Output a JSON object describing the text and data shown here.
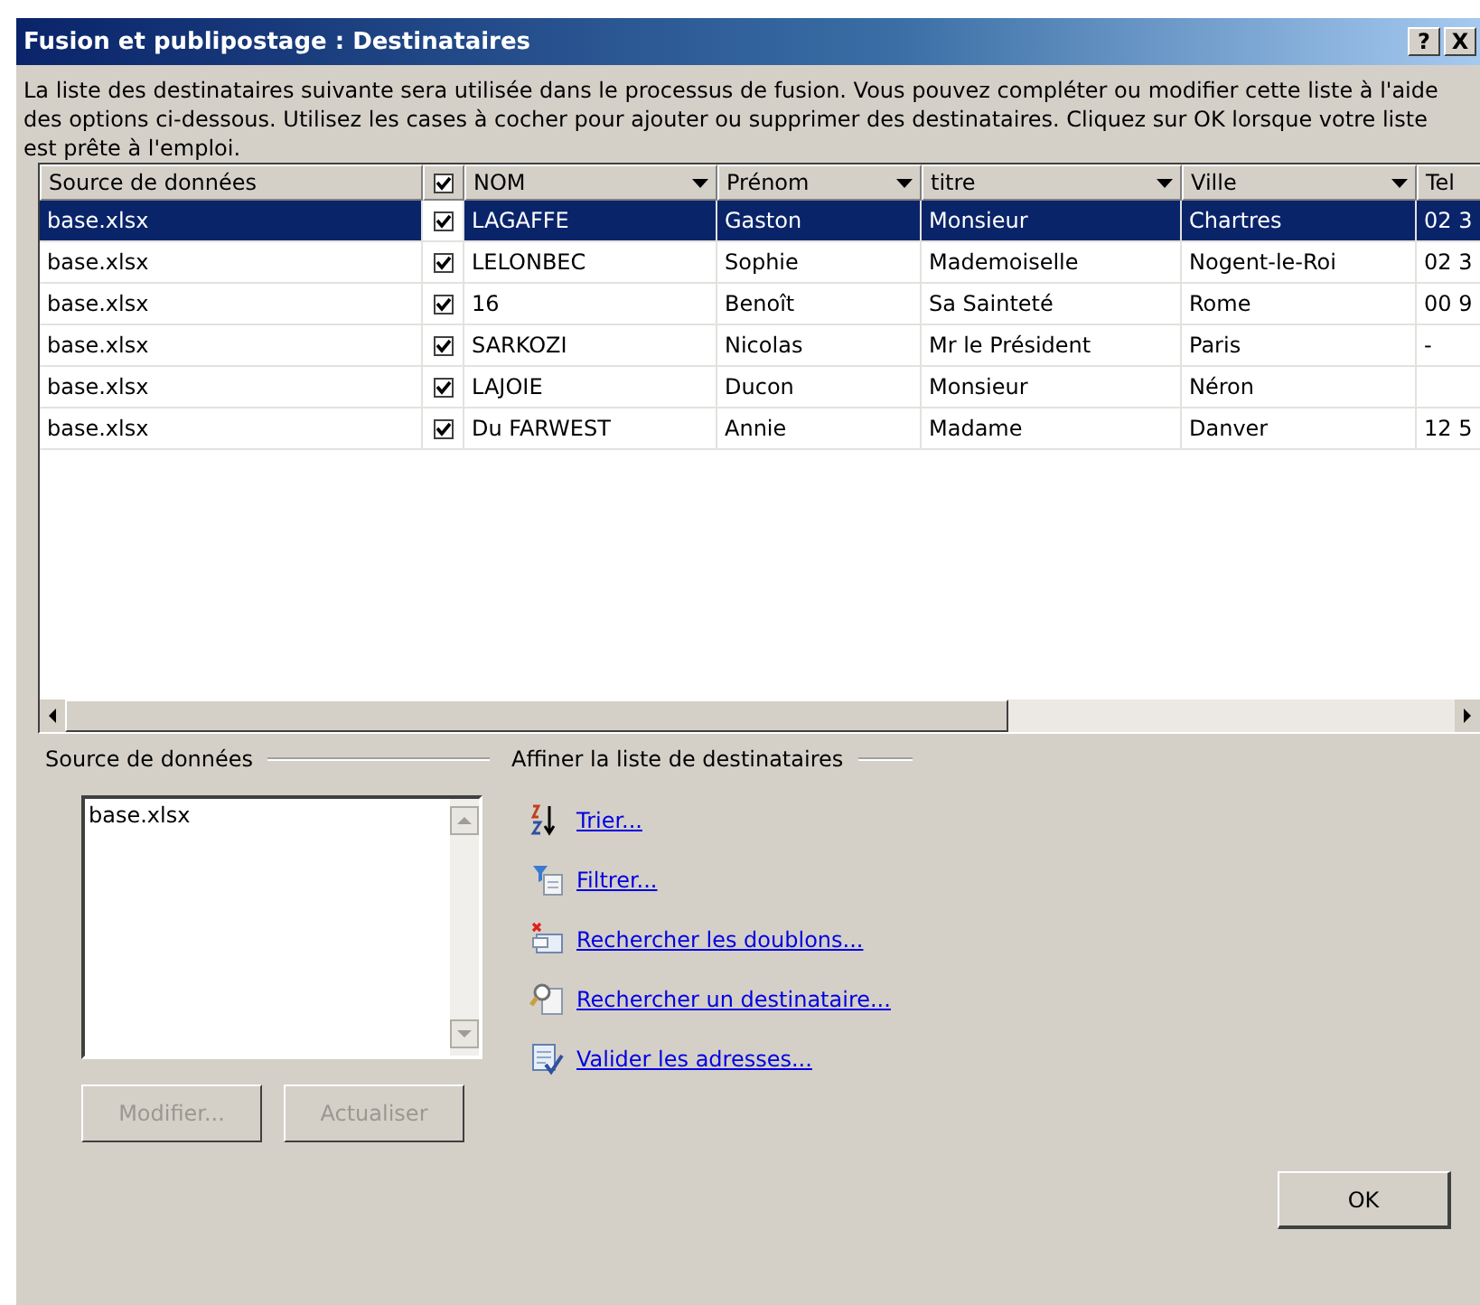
{
  "window": {
    "title": "Fusion et publipostage : Destinataires",
    "help": "?",
    "close": "X"
  },
  "intro": "La liste des destinataires suivante sera utilisée dans le processus de fusion. Vous pouvez compléter ou modifier cette liste à l'aide des options ci-dessous. Utilisez les cases à cocher pour ajouter ou supprimer des destinataires. Cliquez sur OK lorsque votre liste est prête à l'emploi.",
  "table": {
    "columns": [
      {
        "label": "Source de données",
        "kind": "text",
        "dropdown": false
      },
      {
        "kind": "check",
        "checked": true
      },
      {
        "label": "NOM",
        "kind": "text",
        "dropdown": true
      },
      {
        "label": "Prénom",
        "kind": "text",
        "dropdown": true
      },
      {
        "label": "titre",
        "kind": "text",
        "dropdown": true
      },
      {
        "label": "Ville",
        "kind": "text",
        "dropdown": true
      },
      {
        "label": "Tel",
        "kind": "text"
      }
    ],
    "rows": [
      {
        "selected": true,
        "checked": true,
        "cells": [
          "base.xlsx",
          "",
          "LAGAFFE",
          "Gaston",
          "Monsieur",
          "Chartres",
          "02 3"
        ]
      },
      {
        "selected": false,
        "checked": true,
        "cells": [
          "base.xlsx",
          "",
          "LELONBEC",
          "Sophie",
          "Mademoiselle",
          "Nogent-le-Roi",
          "02 3"
        ]
      },
      {
        "selected": false,
        "checked": true,
        "cells": [
          "base.xlsx",
          "",
          "16",
          "Benoît",
          "Sa Sainteté",
          "Rome",
          "00 9"
        ]
      },
      {
        "selected": false,
        "checked": true,
        "cells": [
          "base.xlsx",
          "",
          "SARKOZI",
          "Nicolas",
          "Mr le Président",
          "Paris",
          "-"
        ]
      },
      {
        "selected": false,
        "checked": true,
        "cells": [
          "base.xlsx",
          "",
          "LAJOIE",
          "Ducon",
          "Monsieur",
          "Néron",
          ""
        ]
      },
      {
        "selected": false,
        "checked": true,
        "cells": [
          "base.xlsx",
          "",
          "Du FARWEST",
          "Annie",
          "Madame",
          "Danver",
          "12 5"
        ]
      }
    ]
  },
  "data_source": {
    "heading": "Source de données",
    "items": [
      "base.xlsx"
    ],
    "buttons": [
      {
        "label": "Modifier...",
        "disabled": true
      },
      {
        "label": "Actualiser",
        "disabled": true
      }
    ]
  },
  "refine": {
    "heading": "Affiner la liste de destinataires",
    "links": [
      {
        "label": "Trier...",
        "kind": "sort"
      },
      {
        "label": "Filtrer...",
        "kind": "filter"
      },
      {
        "label": "Rechercher les doublons...",
        "kind": "duplicates"
      },
      {
        "label": "Rechercher un destinataire...",
        "kind": "find"
      },
      {
        "label": "Valider les adresses...",
        "kind": "validate"
      }
    ]
  },
  "ok_button": "OK"
}
